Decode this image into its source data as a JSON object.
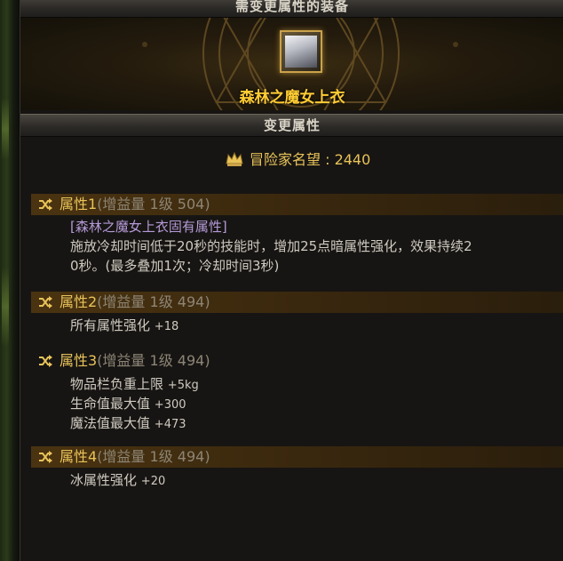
{
  "header": {
    "title": "需变更属性的装备"
  },
  "equipment": {
    "name": "森林之魔女上衣",
    "icon": "white-top-armor-icon"
  },
  "section2": {
    "title": "变更属性"
  },
  "reputation": {
    "label": "冒险家名望",
    "value": "2440",
    "text": "冒险家名望 : 2440"
  },
  "attributes": [
    {
      "title": "属性1",
      "meta": "(增益量 1级 504)",
      "lines": [
        "[森林之魔女上衣固有属性]",
        "施放冷却时间低于20秒的技能时，增加25点暗属性强化，效果持续2",
        "0秒。(最多叠加1次；冷却时间3秒)"
      ]
    },
    {
      "title": "属性2",
      "meta": "(增益量 1级 494)",
      "lines": [
        {
          "name": "所有属性强化",
          "value": "+18"
        }
      ]
    },
    {
      "title": "属性3",
      "meta": "(增益量 1级 494)",
      "lines": [
        {
          "name": "物品栏负重上限",
          "value": "+5kg"
        },
        {
          "name": "生命值最大值",
          "value": "+300"
        },
        {
          "name": "魔法值最大值",
          "value": "+473"
        }
      ]
    },
    {
      "title": "属性4",
      "meta": "(增益量 1级 494)",
      "lines": [
        {
          "name": "冰属性强化",
          "value": "+20"
        }
      ]
    }
  ],
  "colors": {
    "gold": "#e8c35a",
    "item_name": "#ffcc33",
    "unique_text": "#b59ad8",
    "body_text": "#cfcac0",
    "meta_text": "#8d8576"
  }
}
